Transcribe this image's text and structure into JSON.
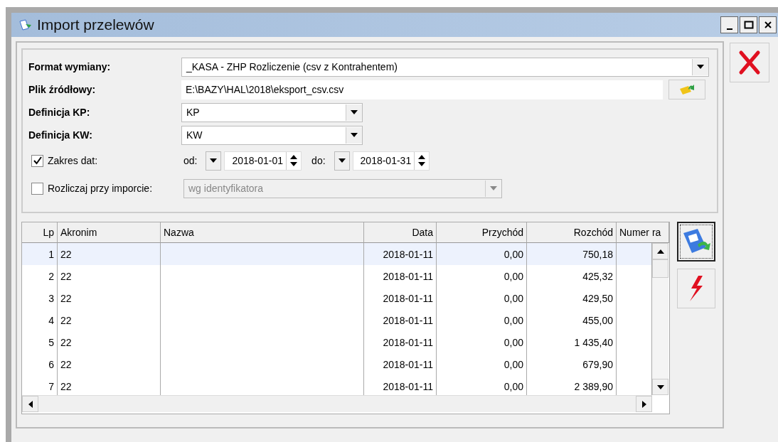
{
  "window": {
    "title": "Import przelewów"
  },
  "form": {
    "format": {
      "label": "Format wymiany:",
      "value": "_KASA - ZHP Rozliczenie (csv z Kontrahentem)"
    },
    "source_file": {
      "label": "Plik źródłowy:",
      "value": "E:\\BAZY\\HAL\\2018\\eksport_csv.csv"
    },
    "kp": {
      "label": "Definicja KP:",
      "value": "KP"
    },
    "kw": {
      "label": "Definicja KW:",
      "value": "KW"
    },
    "date_range": {
      "label": "Zakres dat:",
      "checked": true,
      "from_label": "od:",
      "from": "2018-01-01",
      "to_label": "do:",
      "to": "2018-01-31"
    },
    "settle": {
      "label": "Rozliczaj przy imporcie:",
      "checked": false,
      "value": "wg identyfikatora",
      "disabled": true
    }
  },
  "table": {
    "columns": [
      {
        "label": "Lp"
      },
      {
        "label": "Akronim"
      },
      {
        "label": "Nazwa"
      },
      {
        "label": "Data"
      },
      {
        "label": "Przychód"
      },
      {
        "label": "Rozchód"
      },
      {
        "label": "Numer ra"
      }
    ],
    "rows": [
      {
        "selected": true,
        "cells": [
          "1",
          "22",
          "",
          "2018-01-11",
          "0,00",
          "750,18",
          ""
        ]
      },
      {
        "selected": false,
        "cells": [
          "2",
          "22",
          "",
          "2018-01-11",
          "0,00",
          "425,32",
          ""
        ]
      },
      {
        "selected": false,
        "cells": [
          "3",
          "22",
          "",
          "2018-01-11",
          "0,00",
          "429,50",
          ""
        ]
      },
      {
        "selected": false,
        "cells": [
          "4",
          "22",
          "",
          "2018-01-11",
          "0,00",
          "455,00",
          ""
        ]
      },
      {
        "selected": false,
        "cells": [
          "5",
          "22",
          "",
          "2018-01-11",
          "0,00",
          "1 435,40",
          ""
        ]
      },
      {
        "selected": false,
        "cells": [
          "6",
          "22",
          "",
          "2018-01-11",
          "0,00",
          "679,90",
          ""
        ]
      },
      {
        "selected": false,
        "cells": [
          "7",
          "22",
          "",
          "2018-01-11",
          "0,00",
          "2 389,90",
          ""
        ]
      }
    ]
  }
}
